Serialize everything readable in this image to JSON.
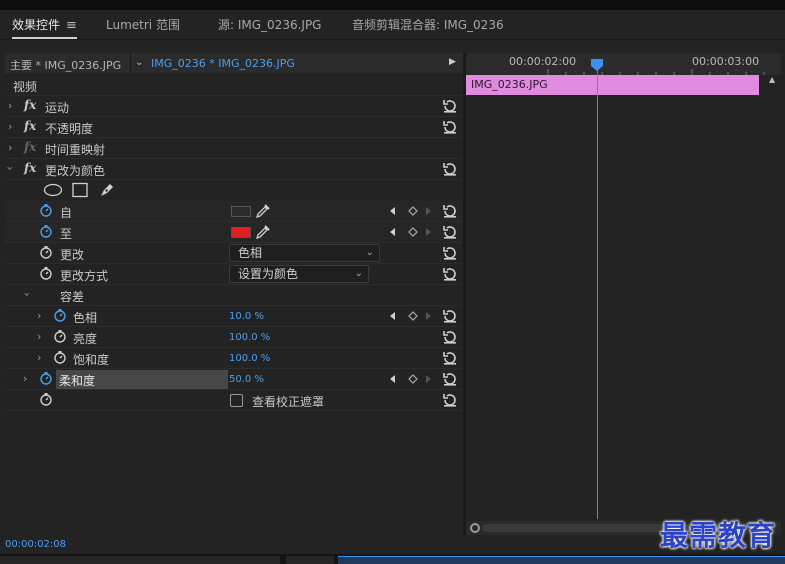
{
  "tabs": [
    {
      "label": "效果控件",
      "active": true
    },
    {
      "label": "Lumetri 范围",
      "active": false
    },
    {
      "label": "源: IMG_0236.JPG",
      "active": false
    },
    {
      "label": "音频剪辑混合器: IMG_0236",
      "active": false
    }
  ],
  "clip_header": {
    "master": "主要 * IMG_0236.JPG",
    "sequence": "IMG_0236 * IMG_0236.JPG"
  },
  "sections": {
    "video": "视频",
    "motion": "运动",
    "opacity": "不透明度",
    "time_remap": "时间重映射",
    "change_to_color": "更改为颜色"
  },
  "fx_label": "fx",
  "params": {
    "from_label": "自",
    "to_label": "至",
    "from_color": "#2a2c30",
    "to_color": "#e02020",
    "change_label": "更改",
    "change_value": "色相",
    "change_by_label": "更改方式",
    "change_by_value": "设置为颜色",
    "tolerance_label": "容差",
    "hue_label": "色相",
    "hue_value": "10.0 %",
    "lightness_label": "亮度",
    "lightness_value": "100.0 %",
    "saturation_label": "饱和度",
    "saturation_value": "100.0 %",
    "softness_label": "柔和度",
    "softness_value": "50.0 %",
    "view_mask_label": "查看校正遮罩"
  },
  "timecode": "00:00:02:08",
  "timeline": {
    "tick_1": "00:00:02:00",
    "tick_2": "00:00:03:00",
    "clip_name": "IMG_0236.JPG",
    "clip_color": "#e08ae0",
    "playhead_color": "#3d8ff0"
  },
  "watermark": "最需教育",
  "accent": "#4c9ff0"
}
